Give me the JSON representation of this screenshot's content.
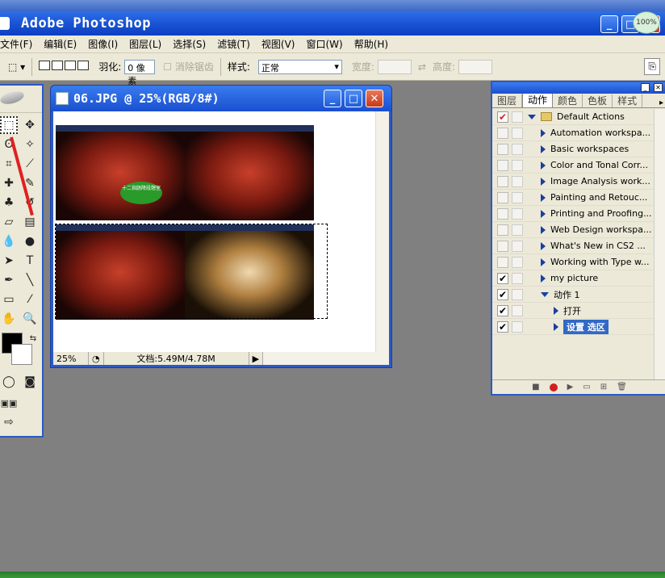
{
  "app": {
    "title": "Adobe Photoshop",
    "net_badge": "100%"
  },
  "menu": [
    "文件(F)",
    "编辑(E)",
    "图像(I)",
    "图层(L)",
    "选择(S)",
    "滤镜(T)",
    "视图(V)",
    "窗口(W)",
    "帮助(H)"
  ],
  "options": {
    "feather_label": "羽化:",
    "feather_value": "0 像素",
    "antialias_label": "消除锯齿",
    "style_label": "样式:",
    "style_value": "正常",
    "width_label": "宽度:",
    "height_label": "高度:"
  },
  "document": {
    "title": "06.JPG @ 25%(RGB/8#)",
    "zoom": "25%",
    "doc_size": "文档:5.49M/4.78M",
    "bubble_text": "十二指肠降段憩室"
  },
  "panel": {
    "tabs": [
      "图层",
      "动作",
      "颜色",
      "色板",
      "样式"
    ],
    "active_tab": "动作",
    "rows": [
      {
        "label": "Default Actions",
        "level": 0,
        "type": "set",
        "check": "red",
        "expanded": true
      },
      {
        "label": "Automation workspa...",
        "level": 1,
        "type": "action",
        "check": "off"
      },
      {
        "label": "Basic workspaces",
        "level": 1,
        "type": "action",
        "check": "off"
      },
      {
        "label": "Color and Tonal Corr...",
        "level": 1,
        "type": "action",
        "check": "off"
      },
      {
        "label": "Image Analysis work...",
        "level": 1,
        "type": "action",
        "check": "off"
      },
      {
        "label": "Painting and Retouc...",
        "level": 1,
        "type": "action",
        "check": "off"
      },
      {
        "label": "Printing and Proofing...",
        "level": 1,
        "type": "action",
        "check": "off"
      },
      {
        "label": "Web Design workspa...",
        "level": 1,
        "type": "action",
        "check": "off"
      },
      {
        "label": "What's New in CS2 ...",
        "level": 1,
        "type": "action",
        "check": "off"
      },
      {
        "label": "Working with Type w...",
        "level": 1,
        "type": "action",
        "check": "off"
      },
      {
        "label": "my picture",
        "level": 1,
        "type": "action",
        "check": "on"
      },
      {
        "label": "动作 1",
        "level": 1,
        "type": "action",
        "check": "on",
        "expanded": true
      },
      {
        "label": "打开",
        "level": 2,
        "type": "step",
        "check": "on"
      },
      {
        "label": "设置 选区",
        "level": 2,
        "type": "step",
        "check": "on",
        "highlighted": true
      }
    ]
  }
}
